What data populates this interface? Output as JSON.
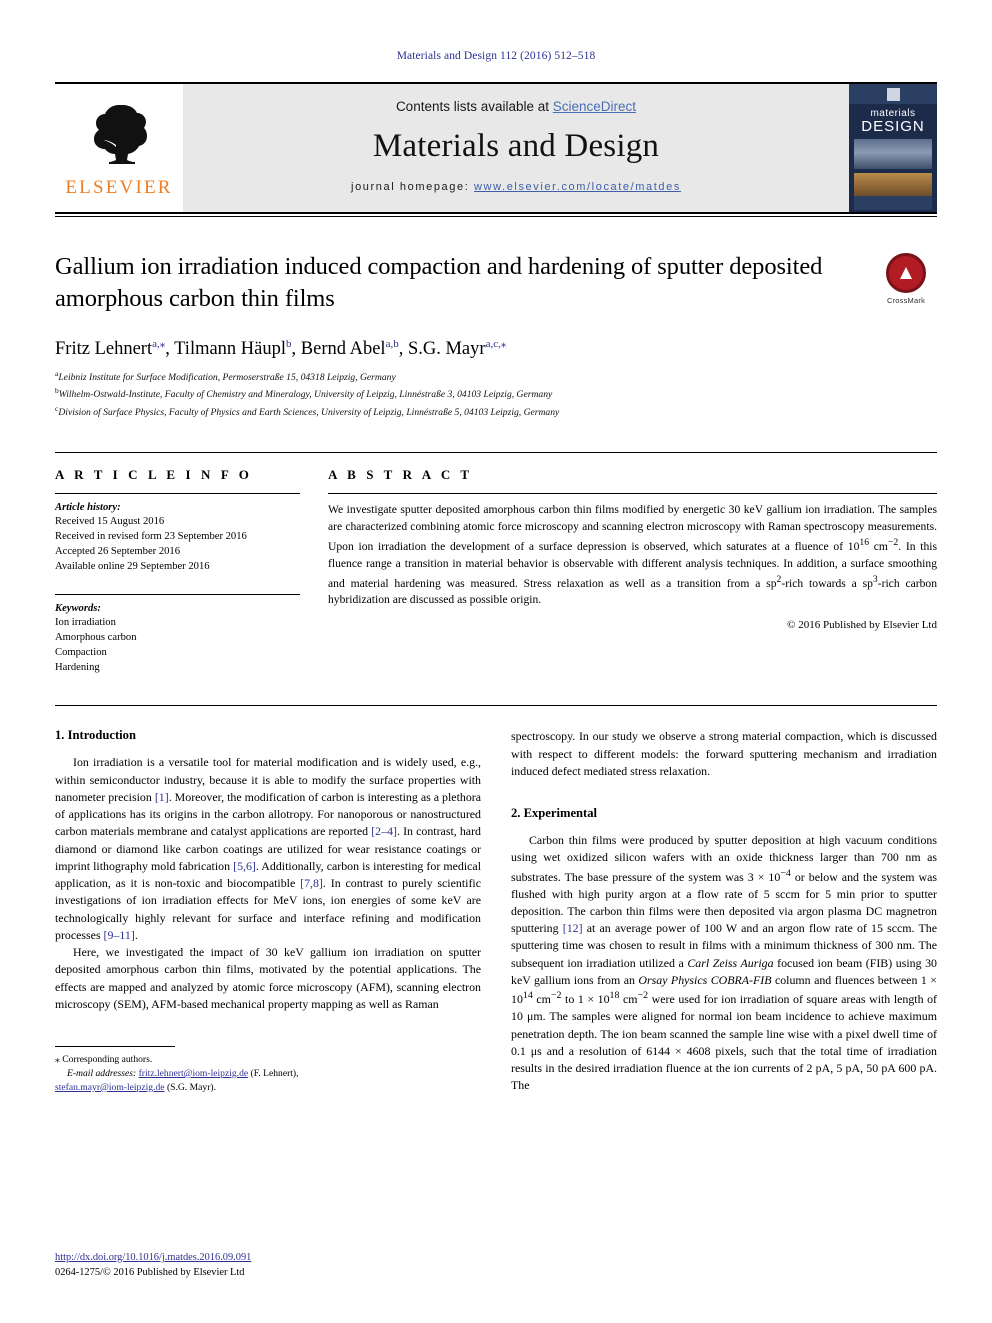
{
  "running_head": "Materials and Design 112 (2016) 512–518",
  "masthead": {
    "publisher_name": "ELSEVIER",
    "contents_prefix": "Contents lists available at ",
    "contents_link": "ScienceDirect",
    "journal_title": "Materials and Design",
    "homepage_label": "journal homepage: ",
    "homepage_url": "www.elsevier.com/locate/matdes",
    "cover": {
      "line1": "materials",
      "line2": "DESIGN"
    }
  },
  "article": {
    "title": "Gallium ion irradiation induced compaction and hardening of sputter deposited amorphous carbon thin films",
    "crossmark_label": "CrossMark",
    "authors_html": "Fritz Lehnert<sup>a,⁎</sup>, Tilmann Häupl<sup>b</sup>, Bernd Abel<sup>a,b</sup>, S.G. Mayr<sup>a,c,⁎</sup>",
    "affiliations": [
      {
        "marker": "a",
        "text": "Leibniz Institute for Surface Modification, Permoserstraße 15, 04318 Leipzig, Germany"
      },
      {
        "marker": "b",
        "text": "Wilhelm-Ostwald-Institute, Faculty of Chemistry and Mineralogy, University of Leipzig, Linnéstraße 3, 04103 Leipzig, Germany"
      },
      {
        "marker": "c",
        "text": "Division of Surface Physics, Faculty of Physics and Earth Sciences, University of Leipzig, Linnéstraße 5, 04103 Leipzig, Germany"
      }
    ]
  },
  "article_info": {
    "heading": "A R T I C L E    I N F O",
    "history_label": "Article history:",
    "history": [
      "Received 15 August 2016",
      "Received in revised form 23 September 2016",
      "Accepted 26 September 2016",
      "Available online 29 September 2016"
    ],
    "keywords_label": "Keywords:",
    "keywords": [
      "Ion irradiation",
      "Amorphous carbon",
      "Compaction",
      "Hardening"
    ]
  },
  "abstract": {
    "heading": "A B S T R A C T",
    "text_html": "We investigate sputter deposited amorphous carbon thin films modified by energetic 30 keV gallium ion irradiation. The samples are characterized combining atomic force microscopy and scanning electron microscopy with Raman spectroscopy measurements. Upon ion irradiation the development of a surface depression is observed, which saturates at a fluence of 10<sup>16</sup> cm<sup>−2</sup>. In this fluence range a transition in material behavior is observable with different analysis techniques. In addition, a surface smoothing and material hardening was measured. Stress relaxation as well as a transition from a sp<sup>2</sup>-rich towards a sp<sup>3</sup>-rich carbon hybridization are discussed as possible origin.",
    "copyright": "© 2016 Published by Elsevier Ltd"
  },
  "sections": {
    "introduction": {
      "title": "1. Introduction",
      "p1_html": "Ion irradiation is a versatile tool for material modification and is widely used, e.g., within semiconductor industry, because it is able to modify the surface properties with nanometer precision <span class=\"ref\">[1]</span>. Moreover, the modification of carbon is interesting as a plethora of applications has its origins in the carbon allotropy. For nanoporous or nanostructured carbon materials membrane and catalyst applications are reported <span class=\"ref\">[2–4]</span>. In contrast, hard diamond or diamond like carbon coatings are utilized for wear resistance coatings or imprint lithography mold fabrication <span class=\"ref\">[5,6]</span>. Additionally, carbon is interesting for medical application, as it is non-toxic and biocompatible <span class=\"ref\">[7,8]</span>. In contrast to purely scientific investigations of ion irradiation effects for MeV ions, ion energies of some keV are technologically highly relevant for surface and interface refining and modification processes <span class=\"ref\">[9–11]</span>.",
      "p2_html": "Here, we investigated the impact of 30 keV gallium ion irradiation on sputter deposited amorphous carbon thin films, motivated by the potential applications. The effects are mapped and analyzed by atomic force microscopy (AFM), scanning electron microscopy (SEM), AFM-based mechanical property mapping as well as Raman spectroscopy. In our study we observe a strong material compaction, which is discussed with respect to different models: the forward sputtering mechanism and irradiation induced defect mediated stress relaxation."
    },
    "experimental": {
      "title": "2. Experimental",
      "p1_html": "Carbon thin films were produced by sputter deposition at high vacuum conditions using wet oxidized silicon wafers with an oxide thickness larger than 700 nm as substrates. The base pressure of the system was 3 × 10<sup>−4</sup> or below and the system was flushed with high purity argon at a flow rate of 5 sccm for 5 min prior to sputter deposition. The carbon thin films were then deposited via argon plasma DC magnetron sputtering <span class=\"ref\">[12]</span> at an average power of 100 W and an argon flow rate of 15 sccm. The sputtering time was chosen to result in films with a minimum thickness of 300 nm. The subsequent ion irradiation utilized a <span class=\"ital\">Carl Zeiss Auriga</span> focused ion beam (FIB) using 30 keV gallium ions from an <span class=\"ital\">Orsay Physics COBRA-FIB</span> column and fluences between 1 × 10<sup>14</sup> cm<sup>−2</sup> to 1 × 10<sup>18</sup> cm<sup>−2</sup> were used for ion irradiation of square areas with length of 10 μm. The samples were aligned for normal ion beam incidence to achieve maximum penetration depth. The ion beam scanned the sample line wise with a pixel dwell time of 0.1 μs and a resolution of 6144 × 4608 pixels, such that the total time of irradiation results in the desired irradiation fluence at the ion currents of 2 pA, 5 pA, 50 pA 600 pA. The"
    }
  },
  "footnote": {
    "corresponding": "⁎ Corresponding authors.",
    "email_label": "E-mail addresses:",
    "email1": "fritz.lehnert@iom-leipzig.de",
    "email1_name": "(F. Lehnert),",
    "email2": "stefan.mayr@iom-leipzig.de",
    "email2_name": "(S.G. Mayr)."
  },
  "page_footer": {
    "doi": "http://dx.doi.org/10.1016/j.matdes.2016.09.091",
    "issn_line": "0264-1275/© 2016 Published by Elsevier Ltd"
  }
}
